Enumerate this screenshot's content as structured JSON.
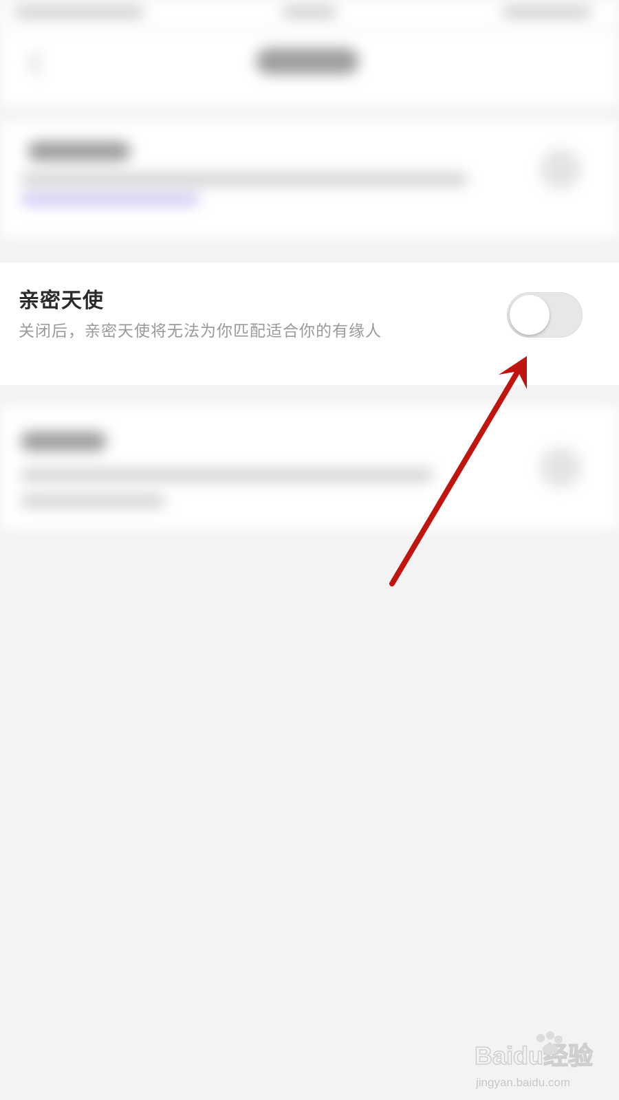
{
  "setting": {
    "title": "亲密天使",
    "description": "关闭后，亲密天使将无法为你匹配适合你的有缘人",
    "toggle_enabled": false
  },
  "watermark": {
    "brand": "Baidu经验",
    "url": "jingyan.baidu.com"
  },
  "colors": {
    "background": "#f3f3f3",
    "arrow": "#c0140f",
    "toggle_off": "#e7e7e7",
    "title_text": "#2a2a2a",
    "desc_text": "#9a9a9a"
  },
  "icons": {
    "back": "chevron-left-icon",
    "annotation": "red-arrow-icon",
    "watermark": "baidu-paw-logo-icon"
  }
}
